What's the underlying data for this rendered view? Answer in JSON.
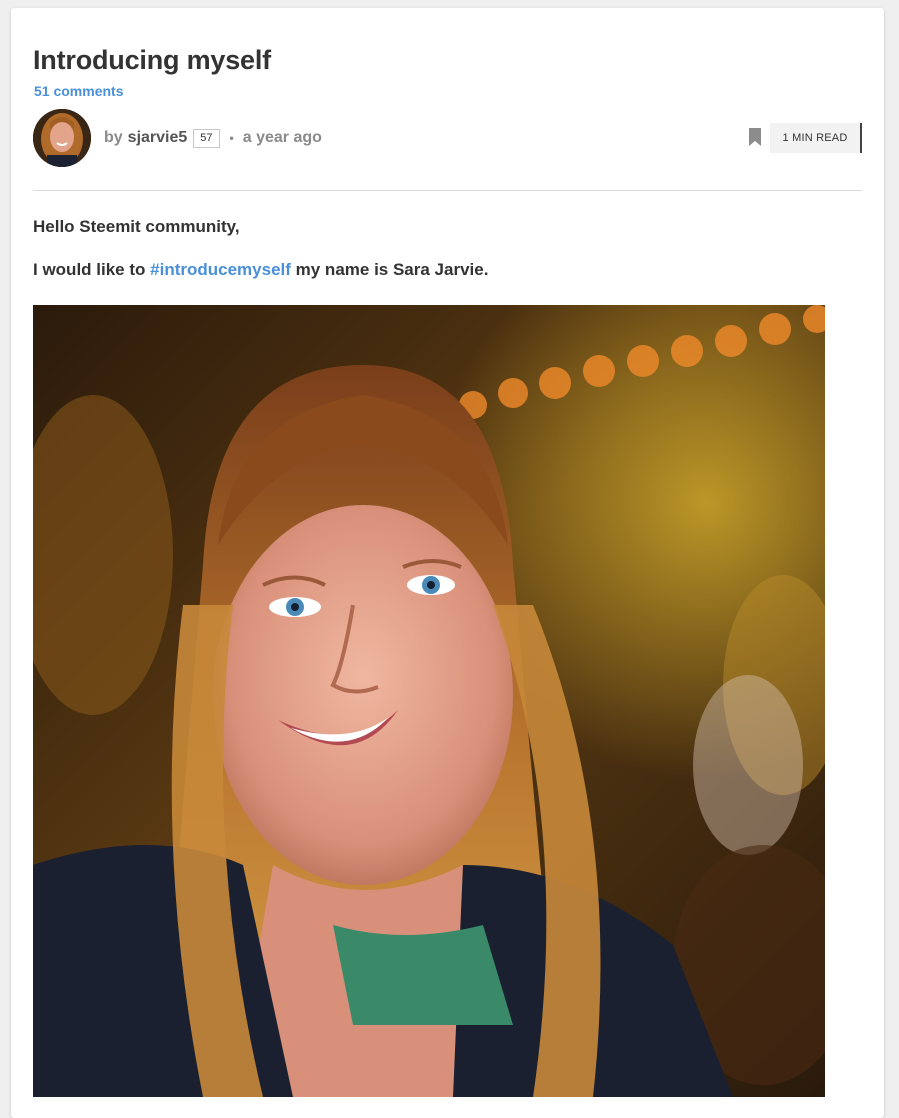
{
  "post": {
    "title": "Introducing myself",
    "comments_label": "51 comments",
    "byline": {
      "by_label": "by",
      "author": "sjarvie5",
      "reputation": "57",
      "separator": "•",
      "time_ago": "a year ago"
    },
    "bookmark_icon": "bookmark-icon",
    "read_time": "1 MIN READ"
  },
  "body": {
    "greeting": "Hello Steemit community,",
    "intro_before": "I would like to",
    "hashtag": "#introducemyself",
    "intro_after": "my name is Sara Jarvie."
  },
  "colors": {
    "link": "#4a90d9",
    "text": "#333333",
    "muted": "#8a8a8a"
  }
}
